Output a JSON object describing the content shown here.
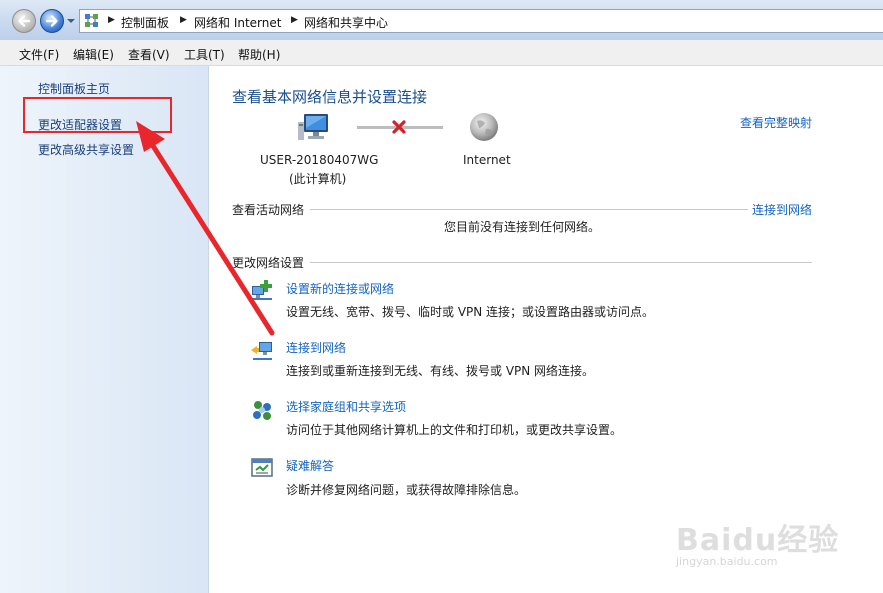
{
  "breadcrumb": [
    "控制面板",
    "网络和 Internet",
    "网络和共享中心"
  ],
  "breadcrumb_sep": "▶",
  "menu": [
    "文件(F)",
    "编辑(E)",
    "查看(V)",
    "工具(T)",
    "帮助(H)"
  ],
  "sidebar": {
    "items": [
      {
        "label": "控制面板主页"
      },
      {
        "label": "更改适配器设置"
      },
      {
        "label": "更改高级共享设置"
      }
    ]
  },
  "main": {
    "title": "查看基本网络信息并设置连接",
    "full_map_link": "查看完整映射",
    "computer_name": "USER-20180407WG",
    "computer_sub": "(此计算机)",
    "internet_label": "Internet",
    "active_networks_heading": "查看活动网络",
    "connect_link": "连接到网络",
    "no_connection_text": "您目前没有连接到任何网络。",
    "change_settings_heading": "更改网络设置",
    "tasks": [
      {
        "title": "设置新的连接或网络",
        "desc": "设置无线、宽带、拨号、临时或 VPN 连接；或设置路由器或访问点。",
        "icon": "new-connection-icon"
      },
      {
        "title": "连接到网络",
        "desc": "连接到或重新连接到无线、有线、拨号或 VPN 网络连接。",
        "icon": "connect-network-icon"
      },
      {
        "title": "选择家庭组和共享选项",
        "desc": "访问位于其他网络计算机上的文件和打印机，或更改共享设置。",
        "icon": "homegroup-icon"
      },
      {
        "title": "疑难解答",
        "desc": "诊断并修复网络问题，或获得故障排除信息。",
        "icon": "troubleshoot-icon"
      }
    ]
  },
  "watermark": {
    "logo": "Baidu经验",
    "url": "jingyan.baidu.com"
  },
  "colors": {
    "link": "#1464c0",
    "title": "#1a4e8e",
    "highlight": "#e8262b",
    "sidebar": "#d9e6f5"
  }
}
